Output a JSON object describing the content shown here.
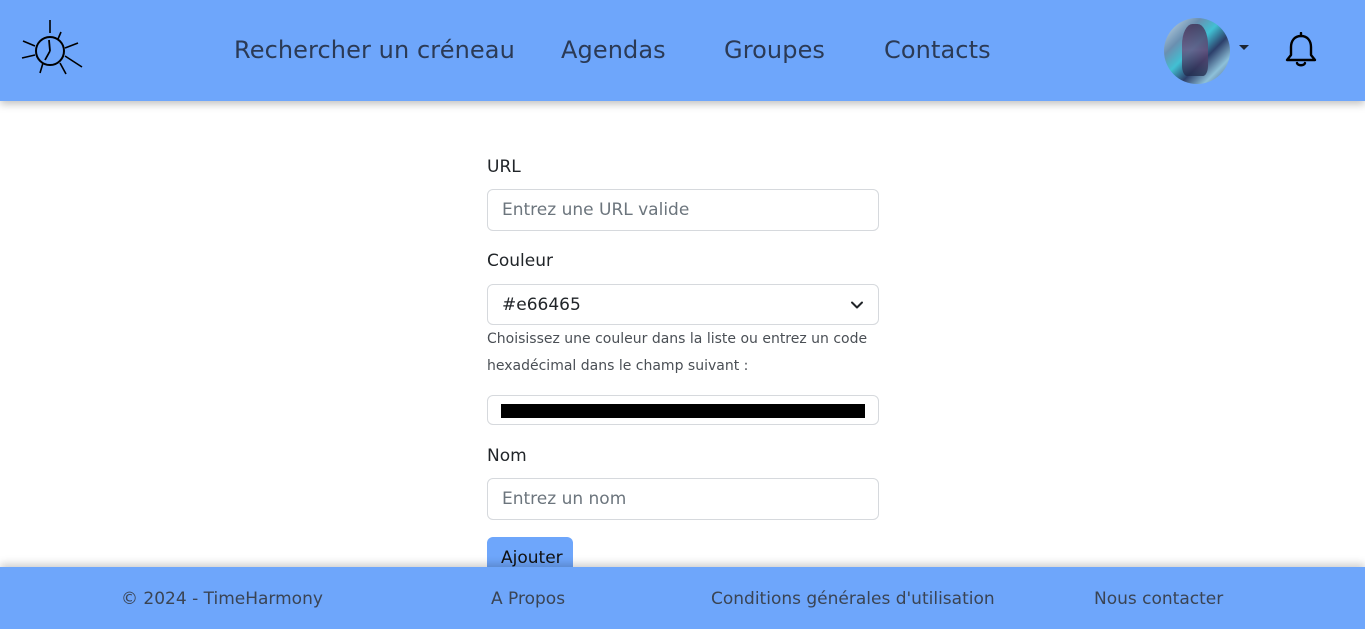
{
  "nav": {
    "links": [
      "Rechercher un créneau",
      "Agendas",
      "Groupes",
      "Contacts"
    ]
  },
  "icons": {
    "logo": "sun-clock-logo-icon",
    "avatar": "user-avatar",
    "caret": "caret-down-icon",
    "bell": "bell-icon",
    "chevron": "chevron-down-icon"
  },
  "form": {
    "url_label": "URL",
    "url_placeholder": "Entrez une URL valide",
    "color_label": "Couleur",
    "color_selected": "#e66465",
    "color_help": "Choisissez une couleur dans la liste ou entrez un code hexadécimal dans le champ suivant :",
    "color_picker_value": "#000000",
    "name_label": "Nom",
    "name_placeholder": "Entrez un nom",
    "submit_label": "Ajouter"
  },
  "footer": {
    "copyright": "© 2024 - TimeHarmony",
    "about": "A Propos",
    "terms": "Conditions générales d'utilisation",
    "contact": "Nous contacter"
  },
  "colors": {
    "primary": "#6ea6fb",
    "nav_text": "#2b3a55"
  }
}
